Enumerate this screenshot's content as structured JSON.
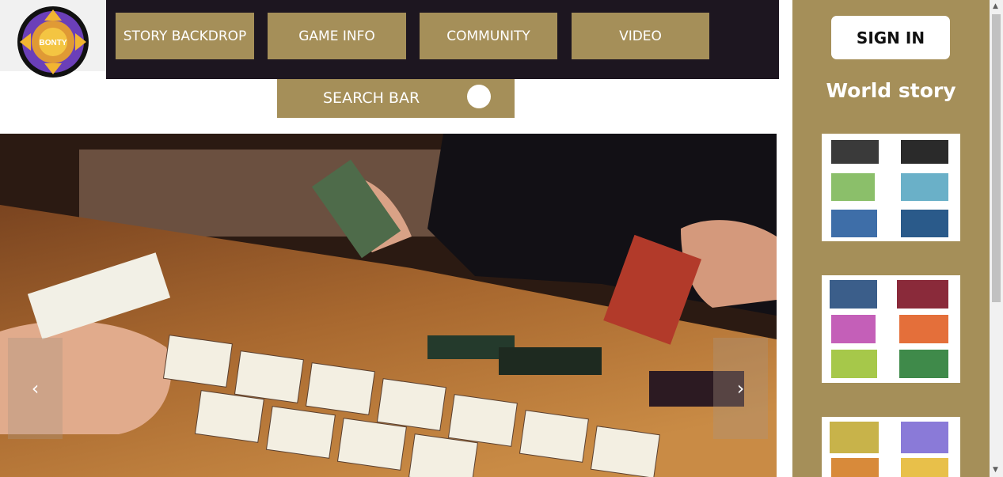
{
  "logo": {
    "text": "BONTY"
  },
  "nav": {
    "story": "STORY BACKDROP",
    "game_info": "GAME INFO",
    "community": "COMMUNITY",
    "video": "VIDEO"
  },
  "search": {
    "label": "SEARCH BAR"
  },
  "carousel": {
    "prev": "‹",
    "next": "›"
  },
  "sidebar": {
    "signin": "SIGN IN",
    "heading": "World story"
  },
  "colors": {
    "gold": "#a58f59",
    "topbar": "#1d1620",
    "white": "#ffffff"
  },
  "icons": {
    "prev": "chevron-left-icon",
    "next": "chevron-right-icon",
    "search_toggle": "toggle-knob-icon"
  }
}
